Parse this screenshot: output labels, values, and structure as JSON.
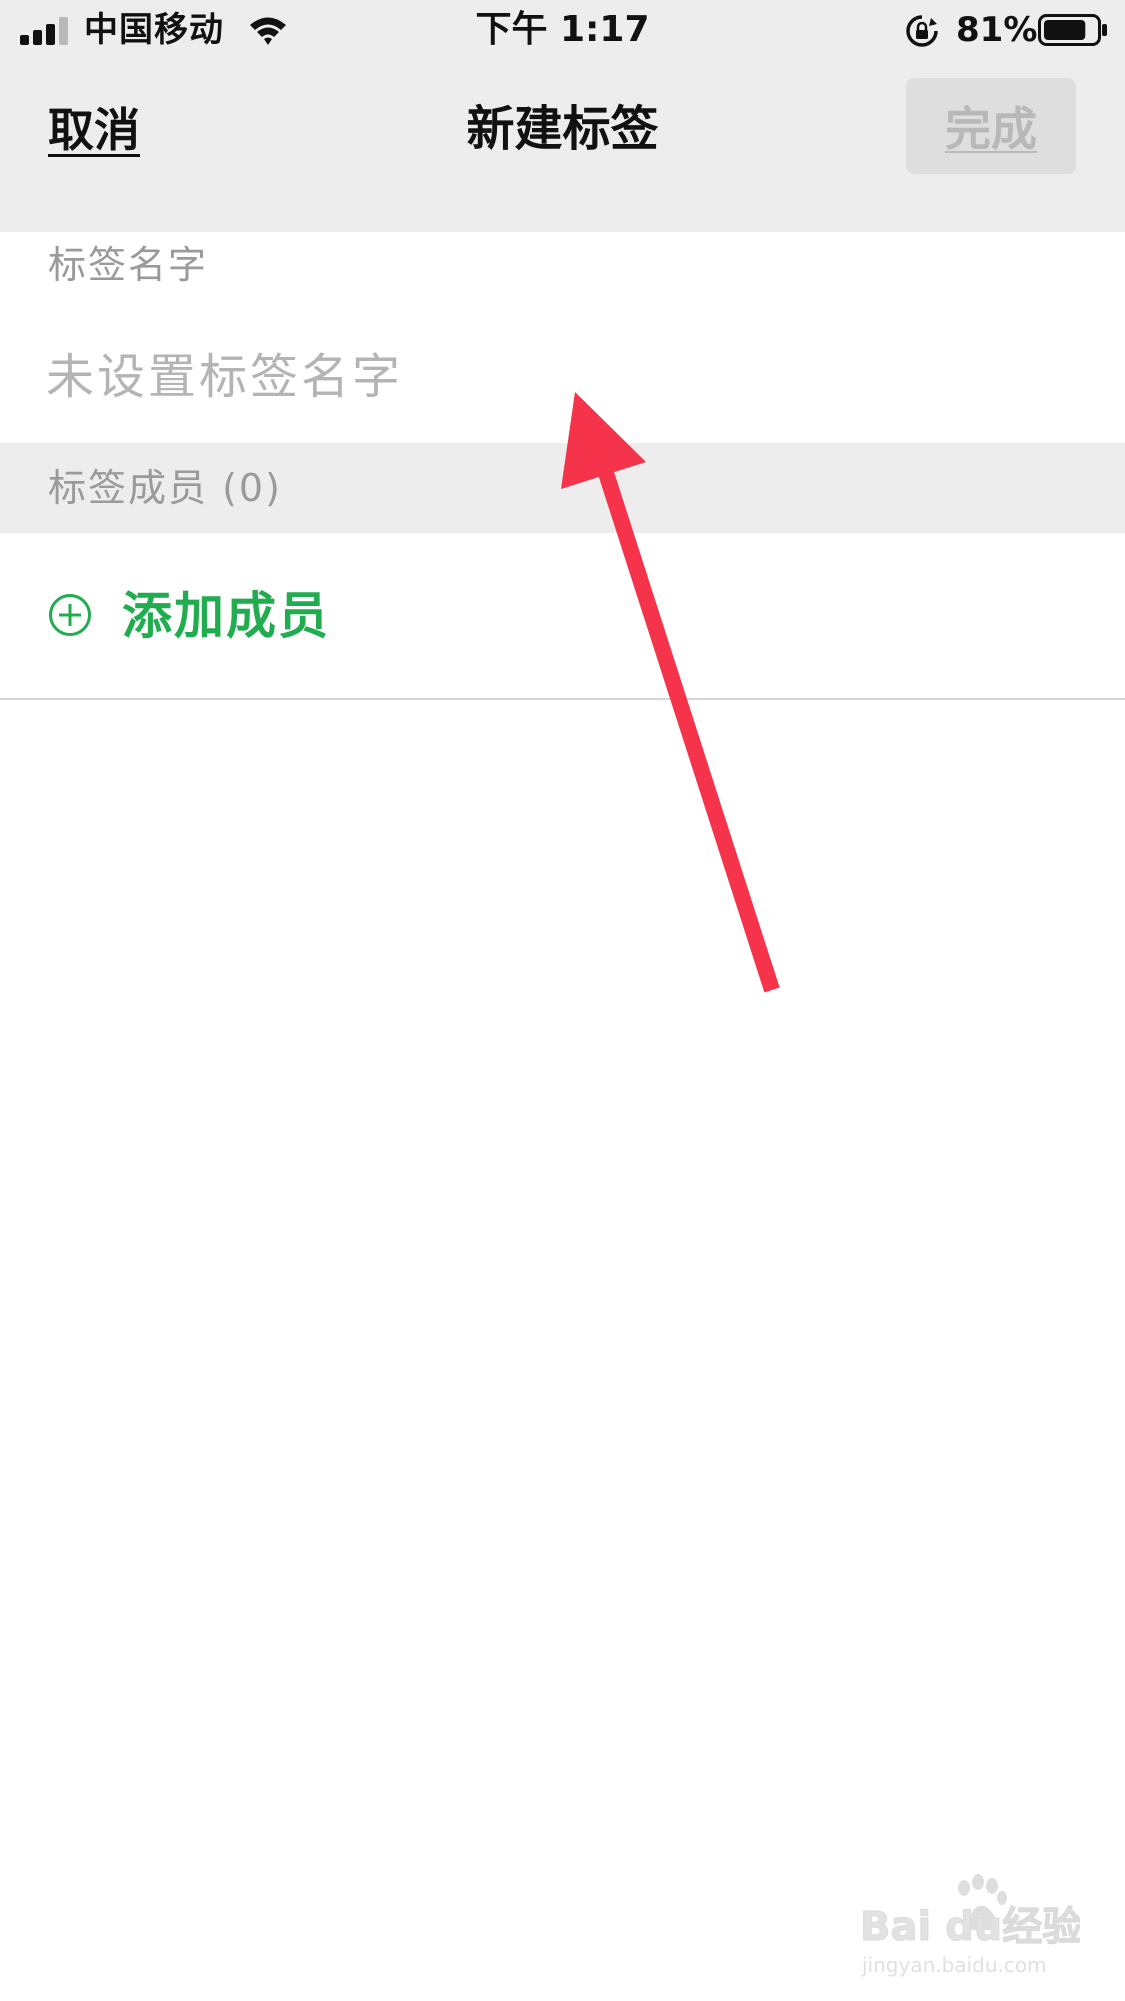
{
  "status_bar": {
    "carrier": "中国移动",
    "time": "下午 1:17",
    "battery_percent": "81%",
    "signal_icon": "signal-bars-icon",
    "wifi_icon": "wifi-icon",
    "rotation_lock_icon": "rotation-lock-icon",
    "battery_icon": "battery-icon",
    "battery_level": 0.81
  },
  "nav": {
    "cancel_label": "取消",
    "title": "新建标签",
    "done_label": "完成"
  },
  "form": {
    "name_section_label": "标签名字",
    "name_placeholder": "未设置标签名字",
    "name_value": "",
    "members_section_label": "标签成员 (0)",
    "add_member_label": "添加成员",
    "add_member_icon": "circle-plus-icon"
  },
  "colors": {
    "accent_green": "#21ad4f",
    "annotation_red": "#f5334a",
    "header_gray": "#ededed",
    "placeholder_gray": "#b4b4b4",
    "section_label_gray": "#9a9a9a"
  },
  "watermark": {
    "brand_icon": "baidu-paw-icon",
    "brand_logo": "Baidu经验",
    "domain": "jingyan.baidu.com"
  }
}
